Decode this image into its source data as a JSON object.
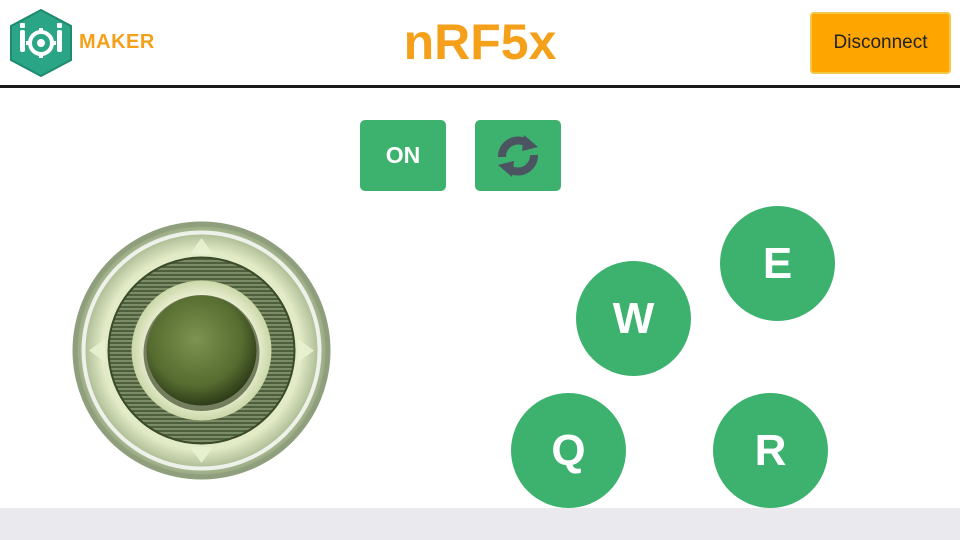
{
  "header": {
    "logo_text": "MAKER",
    "title": "nRF5x",
    "disconnect_label": "Disconnect"
  },
  "controls": {
    "on_label": "ON",
    "refresh_icon": "refresh-icon"
  },
  "joystick": {
    "icon": "joystick-dpad"
  },
  "action_buttons": [
    {
      "label": "E"
    },
    {
      "label": "W"
    },
    {
      "label": "Q"
    },
    {
      "label": "R"
    }
  ],
  "colors": {
    "brand_orange": "#f5a01a",
    "disconnect_bg": "#ffa500",
    "button_green": "#3db26f",
    "logo_teal": "#2aa586",
    "refresh_icon_color": "#4b5460"
  }
}
